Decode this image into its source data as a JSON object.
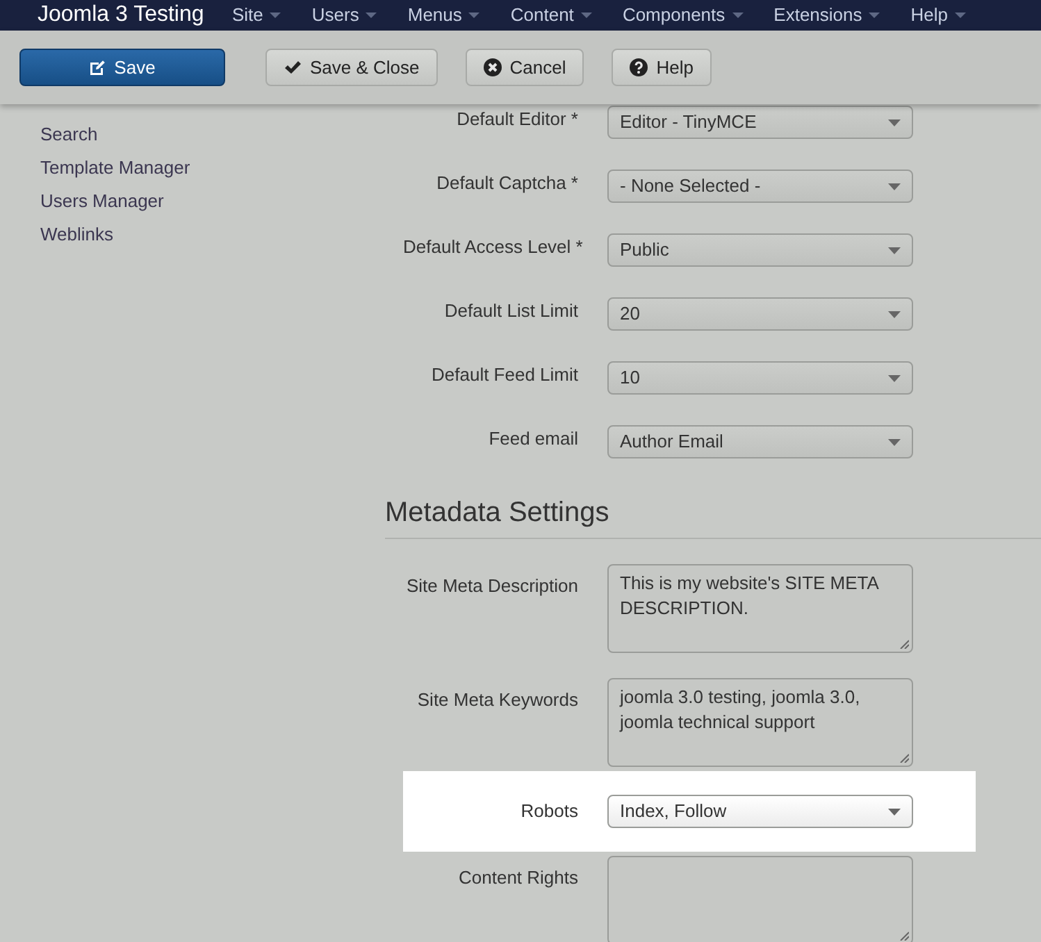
{
  "navbar": {
    "brand": "Joomla 3 Testing",
    "menus": [
      {
        "label": "Site"
      },
      {
        "label": "Users"
      },
      {
        "label": "Menus"
      },
      {
        "label": "Content"
      },
      {
        "label": "Components"
      },
      {
        "label": "Extensions"
      },
      {
        "label": "Help"
      }
    ]
  },
  "toolbar": [
    {
      "label": "Save",
      "kind": "primary"
    },
    {
      "label": "Save & Close",
      "kind": "default"
    },
    {
      "label": "Cancel",
      "kind": "default"
    },
    {
      "label": "Help",
      "kind": "default"
    }
  ],
  "sidebar": {
    "items": [
      "Search",
      "Template Manager",
      "Users Manager",
      "Weblinks"
    ]
  },
  "form": {
    "fields": [
      {
        "label": "Default Editor *",
        "kind": "select",
        "value": "Editor - TinyMCE",
        "highlighted": false
      },
      {
        "label": "Default Captcha *",
        "kind": "select",
        "value": "- None Selected -",
        "highlighted": false
      },
      {
        "label": "Default Access Level *",
        "kind": "select",
        "value": "Public",
        "highlighted": false
      },
      {
        "label": "Default List Limit",
        "kind": "select",
        "value": "20",
        "highlighted": false
      },
      {
        "label": "Default Feed Limit",
        "kind": "select",
        "value": "10",
        "highlighted": false
      },
      {
        "label": "Feed email",
        "kind": "select",
        "value": "Author Email",
        "highlighted": false
      }
    ],
    "section": {
      "title": "Metadata Settings",
      "fields": [
        {
          "label": "Site Meta Description",
          "kind": "textarea",
          "value": "This is my website's SITE META DESCRIPTION.",
          "highlighted": false
        },
        {
          "label": "Site Meta Keywords",
          "kind": "textarea",
          "value": "joomla 3.0 testing, joomla 3.0, joomla technical support",
          "highlighted": false
        },
        {
          "label": "Robots",
          "kind": "select",
          "value": "Index, Follow",
          "highlighted": true
        },
        {
          "label": "Content Rights",
          "kind": "textarea",
          "highlighted": false
        }
      ]
    }
  }
}
